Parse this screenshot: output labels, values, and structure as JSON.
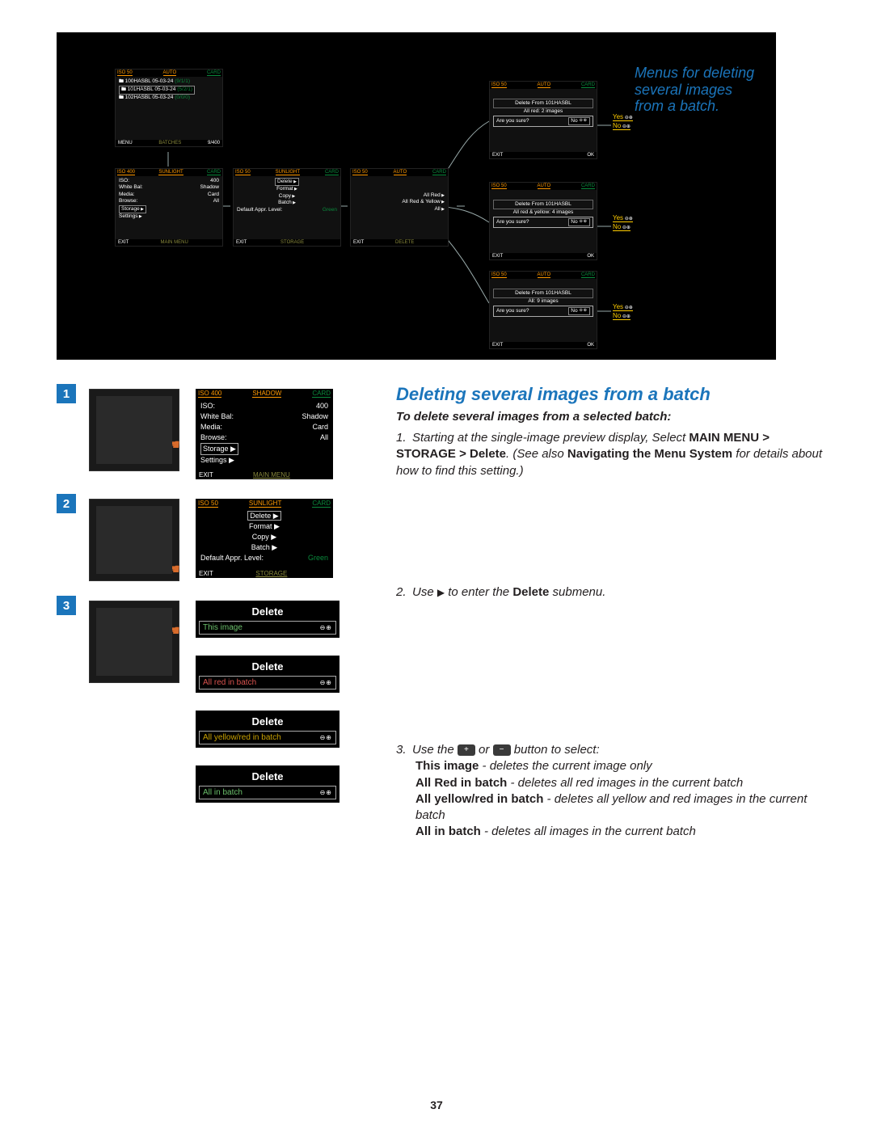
{
  "caption": "Menus for deleting several images from a batch.",
  "page_number": "37",
  "section_heading": "Deleting several images from a batch",
  "section_subtitle": "To delete several images from a selected batch:",
  "step1": {
    "num": "1.",
    "prefix": "Starting at the single-image preview display, Select ",
    "path": "MAIN MENU > STORAGE > Delete",
    "mid": ". (See also ",
    "nav_bold": "Navigating the Menu System",
    "suffix": " for details about how to find this setting.)"
  },
  "step2": {
    "num": "2.",
    "prefix": "Use ",
    "suffix": " to enter the ",
    "bold": "Delete",
    "end": " submenu."
  },
  "step3": {
    "num": "3.",
    "prefix": "Use the ",
    "mid": " or ",
    "suffix": " button to select:",
    "opt1_b": "This image",
    "opt1_t": " - deletes the current image only",
    "opt2_b": "All Red in batch",
    "opt2_t": " - deletes all red images in the current batch",
    "opt3_b": "All yellow/red in batch",
    "opt3_t": " - deletes all yellow and red images in the current batch",
    "opt4_b": "All in batch",
    "opt4_t": " - deletes all images in the current batch"
  },
  "top": {
    "s_batches": {
      "iso": "ISO 50",
      "wb": "AUTO",
      "card": "CARD",
      "b1a": "100HASBL  05-03-24",
      "b1b": "(9/1/1)",
      "b2a": "101HASBL  05-03-24",
      "b2b": "(5/2/1)",
      "b3a": "102HASBL  05-03-24",
      "b3b": "(0/0/0)",
      "fL": "MENU",
      "fM": "BATCHES",
      "fR": "9/400"
    },
    "s_main": {
      "iso": "ISO 400",
      "wb": "SUNLIGHT",
      "card": "CARD",
      "r1a": "ISO:",
      "r1b": "400",
      "r2a": "White Bal:",
      "r2b": "Shadow",
      "r3a": "Media:",
      "r3b": "Card",
      "r4a": "Browse:",
      "r4b": "All",
      "r5": "Storage",
      "r6": "Settings",
      "fL": "EXIT",
      "fM": "MAIN MENU"
    },
    "s_storage": {
      "iso": "ISO 50",
      "wb": "SUNLIGHT",
      "card": "CARD",
      "r1": "Delete",
      "r2": "Format",
      "r3": "Copy",
      "r4": "Batch",
      "r5a": "Default Appr. Level:",
      "r5b": "Green",
      "fL": "EXIT",
      "fM": "STORAGE"
    },
    "s_delete": {
      "iso": "ISO 50",
      "wb": "AUTO",
      "card": "CARD",
      "r1": "All Red",
      "r2": "All Red & Yellow",
      "r3": "All",
      "fL": "EXIT",
      "fM": "DELETE"
    },
    "conf1": {
      "iso": "ISO 50",
      "wb": "AUTO",
      "card": "CARD",
      "title": "Delete From 101HASBL",
      "line1": "All red: 2 images",
      "sure": "Are you sure?",
      "no": "No",
      "fL": "EXIT",
      "fR": "OK"
    },
    "conf2": {
      "iso": "ISO 50",
      "wb": "AUTO",
      "card": "CARD",
      "title": "Delete From 101HASBL",
      "line1": "All red & yellow: 4 images",
      "sure": "Are you sure?",
      "no": "No",
      "fL": "EXIT",
      "fR": "OK"
    },
    "conf3": {
      "iso": "ISO 50",
      "wb": "AUTO",
      "card": "CARD",
      "title": "Delete From 101HASBL",
      "line1": "All: 9 images",
      "sure": "Are you sure?",
      "no": "No",
      "fL": "EXIT",
      "fR": "OK"
    },
    "legend_yes": "Yes",
    "legend_no": "No"
  },
  "menu1": {
    "iso": "ISO 400",
    "wb": "SHADOW",
    "card": "CARD",
    "r1a": "ISO:",
    "r1b": "400",
    "r2a": "White Bal:",
    "r2b": "Shadow",
    "r3a": "Media:",
    "r3b": "Card",
    "r4a": "Browse:",
    "r4b": "All",
    "r5": "Storage",
    "r6": "Settings",
    "fL": "EXIT",
    "fM": "MAIN MENU"
  },
  "menu2": {
    "iso": "ISO 50",
    "wb": "SUNLIGHT",
    "card": "CARD",
    "r1": "Delete",
    "r2": "Format",
    "r3": "Copy",
    "r4": "Batch",
    "r5a": "Default Appr. Level:",
    "r5b": "Green",
    "fL": "EXIT",
    "fM": "STORAGE"
  },
  "del_header": "Delete",
  "del_opt1": "This image",
  "del_opt2": "All red in batch",
  "del_opt3": "All yellow/red in batch",
  "del_opt4": "All in batch",
  "pm": "⊖⊕",
  "step_marker_1": "1",
  "step_marker_2": "2",
  "step_marker_3": "3"
}
